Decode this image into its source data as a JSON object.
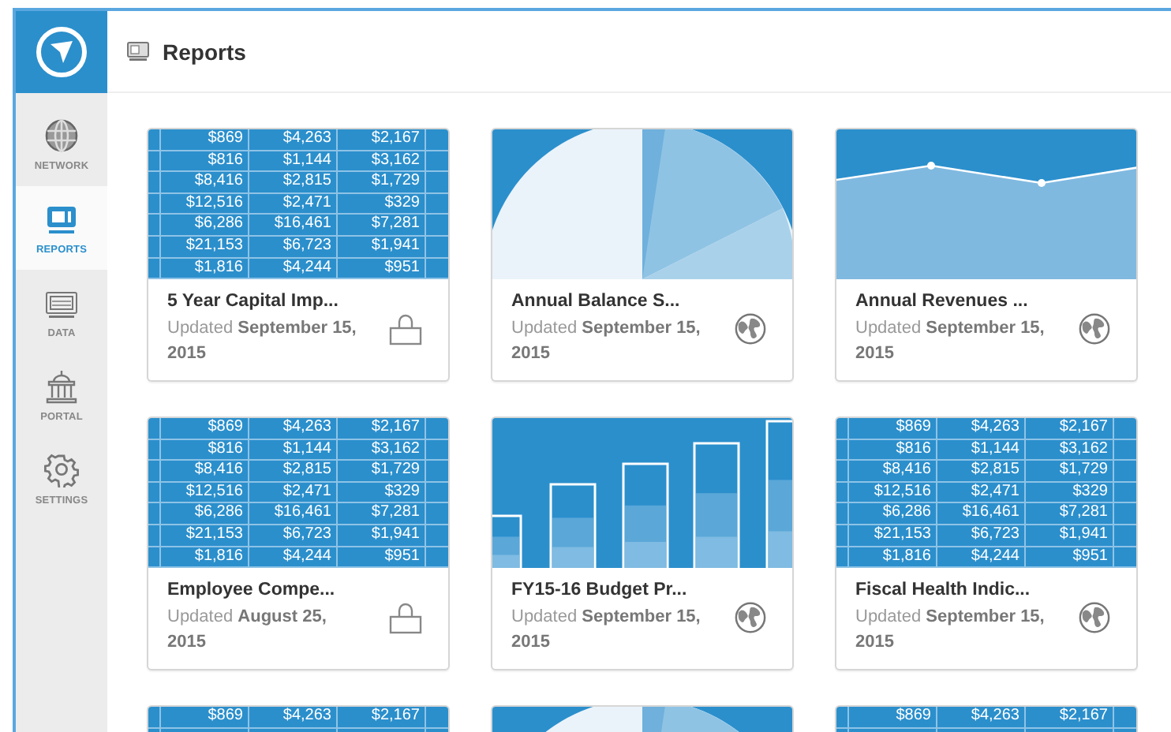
{
  "header": {
    "title": "Reports"
  },
  "sidebar": {
    "items": [
      {
        "label": "NETWORK",
        "selected": false
      },
      {
        "label": "REPORTS",
        "selected": true
      },
      {
        "label": "DATA",
        "selected": false
      },
      {
        "label": "PORTAL",
        "selected": false
      },
      {
        "label": "SETTINGS",
        "selected": false
      }
    ]
  },
  "cards": [
    {
      "kind": "table",
      "title": "5 Year Capital Imp...",
      "updated": "Updated **September 15, 2015**",
      "shared": false,
      "rows": [
        [
          "$869",
          "$4,263",
          "$2,167"
        ],
        [
          "$816",
          "$1,144",
          "$3,162"
        ],
        [
          "$8,416",
          "$2,815",
          "$1,729"
        ],
        [
          "$12,516",
          "$2,471",
          "$329"
        ],
        [
          "$6,286",
          "$16,461",
          "$7,281"
        ],
        [
          "$21,153",
          "$6,723",
          "$1,941"
        ],
        [
          "$1,816",
          "$4,244",
          "$951"
        ]
      ]
    },
    {
      "kind": "pie",
      "title": "Annual Balance S...",
      "updated": "Updated **September 15, 2015**",
      "shared": true
    },
    {
      "kind": "line",
      "title": "Annual Revenues ...",
      "updated": "Updated **September 15, 2015**",
      "shared": true
    },
    {
      "kind": "table",
      "title": "Employee Compe...",
      "updated": "Updated **August 25, 2015**",
      "shared": false,
      "rows": [
        [
          "$869",
          "$4,263",
          "$2,167"
        ],
        [
          "$816",
          "$1,144",
          "$3,162"
        ],
        [
          "$8,416",
          "$2,815",
          "$1,729"
        ],
        [
          "$12,516",
          "$2,471",
          "$329"
        ],
        [
          "$6,286",
          "$16,461",
          "$7,281"
        ],
        [
          "$21,153",
          "$6,723",
          "$1,941"
        ],
        [
          "$1,816",
          "$4,244",
          "$951"
        ]
      ]
    },
    {
      "kind": "bar",
      "title": "FY15-16 Budget Pr...",
      "updated": "Updated **September 15, 2015**",
      "shared": true
    },
    {
      "kind": "table",
      "title": "Fiscal Health Indic...",
      "updated": "Updated **September 15, 2015**",
      "shared": true,
      "rows": [
        [
          "$869",
          "$4,263",
          "$2,167"
        ],
        [
          "$816",
          "$1,144",
          "$3,162"
        ],
        [
          "$8,416",
          "$2,815",
          "$1,729"
        ],
        [
          "$12,516",
          "$2,471",
          "$329"
        ],
        [
          "$6,286",
          "$16,461",
          "$7,281"
        ],
        [
          "$21,153",
          "$6,723",
          "$1,941"
        ],
        [
          "$1,816",
          "$4,244",
          "$951"
        ]
      ]
    },
    {
      "kind": "table",
      "rows": [
        [
          "$869",
          "$4,263",
          "$2,167"
        ]
      ]
    },
    {
      "kind": "pie"
    },
    {
      "kind": "table",
      "rows": [
        [
          "$869",
          "$4,263",
          "$2,167"
        ]
      ]
    }
  ]
}
